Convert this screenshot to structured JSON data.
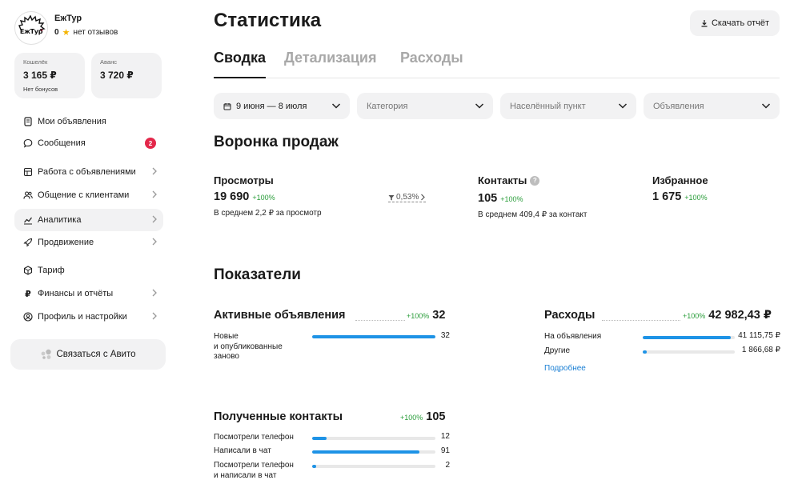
{
  "profile": {
    "logo_text": "ЕжТур",
    "name": "ЕжТур",
    "rating": "0",
    "reviews": "нет отзывов"
  },
  "wallet": {
    "label": "Кошелёк",
    "value": "3 165 ₽",
    "bonus": "Нет бонусов"
  },
  "advance": {
    "label": "Аванс",
    "value": "3 720 ₽"
  },
  "menu": [
    {
      "label": "Мои объявления",
      "icon": "document-icon"
    },
    {
      "label": "Сообщения",
      "icon": "chat-icon",
      "badge": "2"
    },
    {
      "label": "Работа с объявлениями",
      "icon": "grid-icon"
    },
    {
      "label": "Общение с клиентами",
      "icon": "people-icon"
    },
    {
      "label": "Аналитика",
      "icon": "chart-icon",
      "active": true
    },
    {
      "label": "Продвижение",
      "icon": "rocket-icon"
    },
    {
      "label": "Тариф",
      "icon": "box-icon"
    },
    {
      "label": "Финансы и отчёты",
      "icon": "ruble-icon"
    },
    {
      "label": "Профиль и настройки",
      "icon": "user-icon"
    }
  ],
  "contact_avito": "Связаться с Авито",
  "page": {
    "title": "Статистика",
    "download": "Скачать отчёт"
  },
  "tabs": [
    "Сводка",
    "Детализация",
    "Расходы"
  ],
  "filters": {
    "date": "9 июня — 8 июля",
    "category": "Категория",
    "city": "Населённый пункт",
    "ads": "Объявления"
  },
  "funnel": {
    "title": "Воронка продаж",
    "views": {
      "label": "Просмотры",
      "value": "19 690",
      "pct": "+100%",
      "avg": "В среднем 2,2 ₽ за просмотр"
    },
    "conversion": "0,53%",
    "contacts": {
      "label": "Контакты",
      "value": "105",
      "pct": "+100%",
      "avg": "В среднем 409,4 ₽ за контакт"
    },
    "favorites": {
      "label": "Избранное",
      "value": "1 675",
      "pct": "+100%"
    }
  },
  "indicators": {
    "title": "Показатели",
    "active": {
      "title": "Активные объявления",
      "pct": "+100%",
      "total": "32",
      "rows": [
        {
          "label": "Новые\nи опубликованные\nзаново",
          "value": "32",
          "fraction": 1.0
        }
      ]
    },
    "expenses": {
      "title": "Расходы",
      "pct": "+100%",
      "total": "42 982,43 ₽",
      "rows": [
        {
          "label": "На объявления",
          "value": "41 115,75 ₽",
          "fraction": 0.957
        },
        {
          "label": "Другие",
          "value": "1 866,68 ₽",
          "fraction": 0.043
        }
      ],
      "more": "Подробнее"
    },
    "contacts": {
      "title": "Полученные контакты",
      "pct": "+100%",
      "total": "105",
      "rows": [
        {
          "label": "Посмотрели телефон",
          "value": "12",
          "fraction": 0.114
        },
        {
          "label": "Написали в чат",
          "value": "91",
          "fraction": 0.867
        },
        {
          "label": "Посмотрели телефон\nи написали в чат",
          "value": "2",
          "fraction": 0.019
        }
      ]
    }
  },
  "colors": {
    "accent": "#1e93e6",
    "positive": "#2a9d3a",
    "badge": "#e3274a",
    "panel": "#f2f2f3"
  }
}
